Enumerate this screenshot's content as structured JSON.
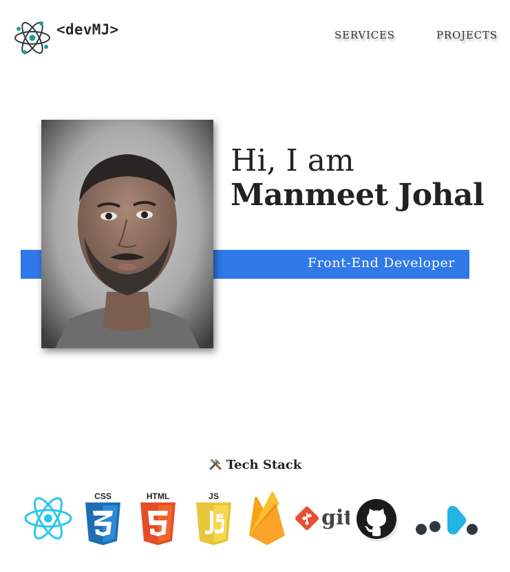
{
  "header": {
    "brand": "<devMJ>",
    "nav": [
      {
        "label": "SERVICES"
      },
      {
        "label": "PROJECTS"
      }
    ]
  },
  "hero": {
    "greeting": "Hi, I am",
    "name": "Manmeet Johal",
    "role": "Front-End Developer"
  },
  "tech": {
    "title": "Tech Stack",
    "icons": [
      {
        "icon": "react-icon"
      },
      {
        "icon": "css3-icon",
        "label": "CSS"
      },
      {
        "icon": "html5-icon",
        "label": "HTML"
      },
      {
        "icon": "javascript-icon",
        "label": "JS"
      },
      {
        "icon": "firebase-icon"
      },
      {
        "icon": "git-icon",
        "label": "git"
      },
      {
        "icon": "github-icon"
      },
      {
        "icon": "netlify-icon"
      }
    ]
  },
  "colors": {
    "accent": "#3178e8",
    "react": "#29c6ef",
    "css": "#1f6db4",
    "html": "#e44d26",
    "js": "#e8c53a",
    "firebase": "#f6a316",
    "git": "#e94e31"
  }
}
